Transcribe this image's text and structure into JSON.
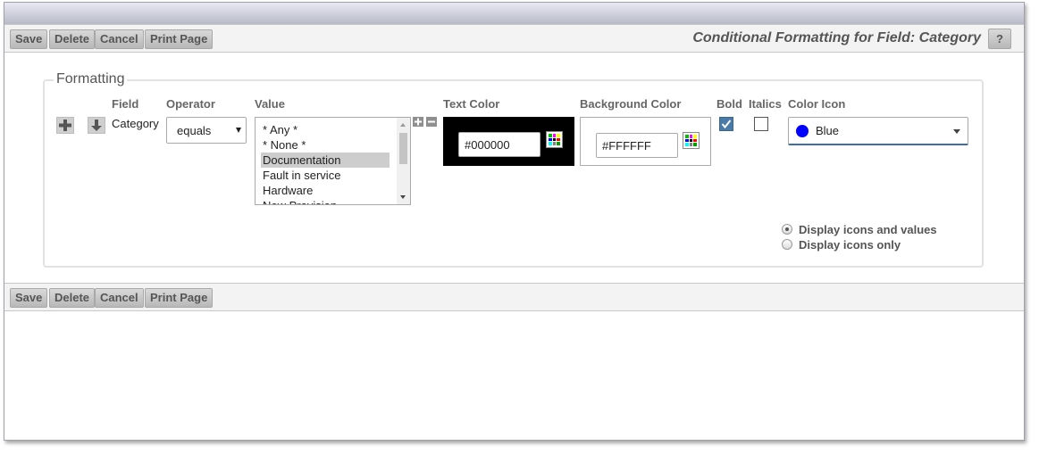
{
  "toolbar": {
    "save": "Save",
    "delete": "Delete",
    "cancel": "Cancel",
    "print": "Print Page",
    "help": "?",
    "title": "Conditional Formatting for Field: Category"
  },
  "formatting": {
    "legend": "Formatting",
    "headers": {
      "field": "Field",
      "operator": "Operator",
      "value": "Value",
      "text_color": "Text Color",
      "background_color": "Background Color",
      "bold": "Bold",
      "italics": "Italics",
      "color_icon": "Color Icon"
    },
    "row": {
      "field": "Category",
      "operator": "equals",
      "values": [
        "* Any *",
        "* None *",
        "Documentation",
        "Fault in service",
        "Hardware",
        "New Provision"
      ],
      "selected_value": "Documentation",
      "text_color": "#000000",
      "background_color": "#FFFFFF",
      "bold": true,
      "italics": false,
      "color_icon": "Blue",
      "color_icon_swatch": "#0000ff"
    },
    "display_options": [
      {
        "label": "Display icons and values",
        "selected": true
      },
      {
        "label": "Display icons only",
        "selected": false
      }
    ]
  },
  "icons": {
    "add": "plus-icon",
    "move_down": "arrow-down-icon",
    "palette": "color-palette-icon"
  }
}
